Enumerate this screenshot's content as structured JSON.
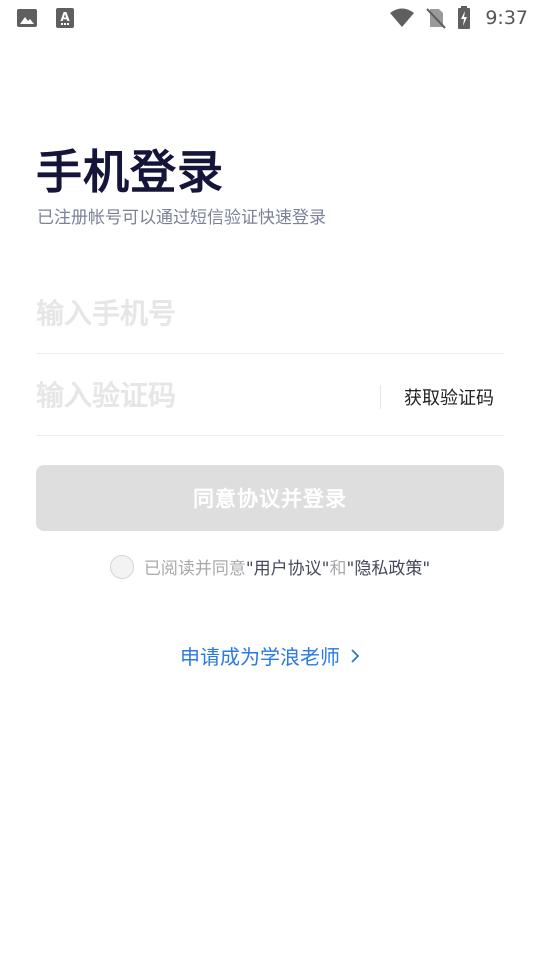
{
  "status_bar": {
    "time": "9:37",
    "left_icons": [
      "image-icon",
      "font-icon"
    ],
    "right_icons": [
      "wifi-icon",
      "no-sim-icon",
      "battery-charging-icon"
    ]
  },
  "login": {
    "title": "手机登录",
    "subtitle": "已注册帐号可以通过短信验证快速登录",
    "phone_placeholder": "输入手机号",
    "code_placeholder": "输入验证码",
    "get_code_label": "获取验证码",
    "submit_label": "同意协议并登录",
    "agreement": {
      "prefix": "已阅读并同意",
      "user_agreement": "\"用户协议\"",
      "conjunction": "和",
      "privacy_policy": "\"隐私政策\""
    },
    "apply_teacher": "申请成为学浪老师"
  },
  "colors": {
    "title": "#15153a",
    "link": "#2a7ae2",
    "button_disabled": "#dedede"
  }
}
